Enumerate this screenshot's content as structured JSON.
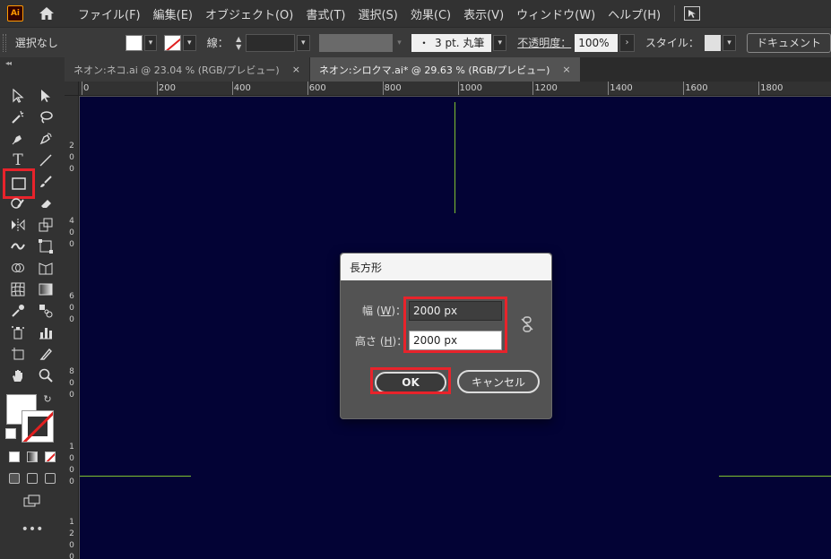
{
  "menubar": {
    "logo": "Ai",
    "items": [
      "ファイル(F)",
      "編集(E)",
      "オブジェクト(O)",
      "書式(T)",
      "選択(S)",
      "効果(C)",
      "表示(V)",
      "ウィンドウ(W)",
      "ヘルプ(H)"
    ]
  },
  "controlbar": {
    "selection_label": "選択なし",
    "stroke_label": "線：",
    "brush": "3 pt. 丸筆",
    "brush_dot": "・",
    "opacity_label": "不透明度：",
    "opacity_value": "100%",
    "style_label": "スタイル：",
    "document_button": "ドキュメント"
  },
  "tabs": [
    {
      "label": "ネオン:ネコ.ai @ 23.04 % (RGB/プレビュー)",
      "close": "×",
      "active": false
    },
    {
      "label": "ネオン:シロクマ.ai* @ 29.63 % (RGB/プレビュー)",
      "close": "×",
      "active": true
    }
  ],
  "ruler": {
    "top": [
      "0",
      "200",
      "400",
      "600",
      "800",
      "1000",
      "1200",
      "1400",
      "1600",
      "1800"
    ],
    "left": [
      "200",
      "400",
      "600",
      "800",
      "1000",
      "1200"
    ]
  },
  "dialog": {
    "title": "長方形",
    "width_label_pre": "幅 (",
    "width_label_key": "W",
    "width_label_post": ")：",
    "width_value": "2000 px",
    "height_label_pre": "高さ (",
    "height_label_key": "H",
    "height_label_post": ")：",
    "height_value": "2000 px",
    "ok": "OK",
    "cancel": "キャンセル"
  },
  "colors": {
    "canvas": "#030335",
    "guide": "#7fc230",
    "highlight": "#e8232b"
  }
}
